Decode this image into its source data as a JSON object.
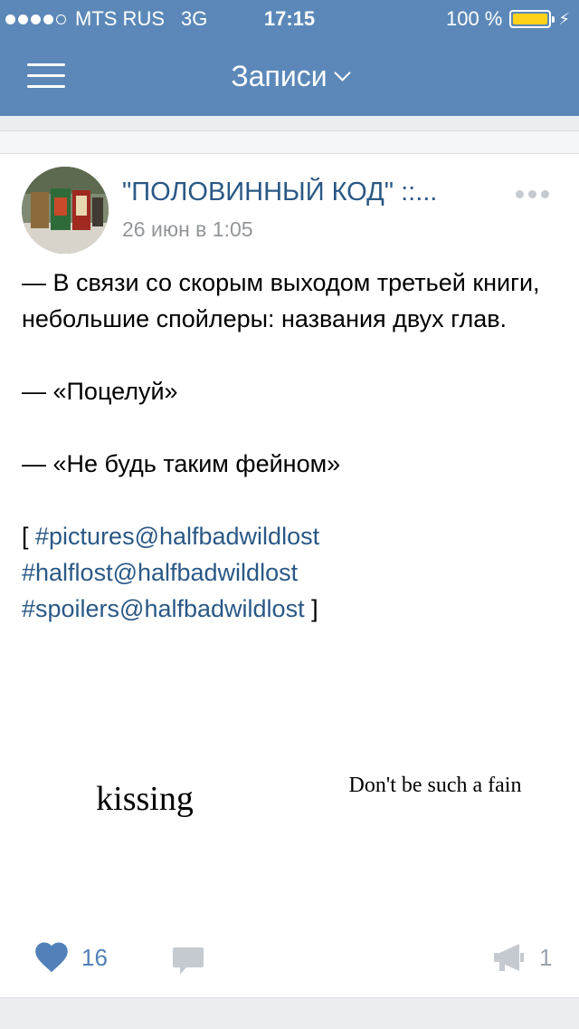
{
  "status_bar": {
    "carrier": "MTS RUS",
    "network": "3G",
    "time": "17:15",
    "battery": "100 %",
    "battery_level_percent": 100
  },
  "nav": {
    "title": "Записи",
    "menu_icon": "hamburger-icon",
    "dropdown_icon": "chevron-down-icon"
  },
  "post": {
    "author": "\"ПОЛОВИННЫЙ КОД\" ::...",
    "date": "26 июн в 1:05",
    "avatar_icon": "group-avatar",
    "lines": [
      "— В связи со скорым выходом третьей книги, небольшие спойлеры: названия двух глав.",
      "— «Поцелуй»",
      "— «Не будь таким фейном»"
    ],
    "tags_open": "[ ",
    "tags": [
      "#pictures@halfbadwildlost",
      "#halflost@halfbadwildlost",
      "#spoilers@halfbadwildlost"
    ],
    "tags_close": " ]",
    "images": [
      {
        "caption": "kissing"
      },
      {
        "caption": "Don't be such a fain"
      }
    ]
  },
  "actions": {
    "likes": "16",
    "shares": "1",
    "like_icon": "heart-icon",
    "comment_icon": "comment-icon",
    "share_icon": "megaphone-icon",
    "like_color": "#5181b8",
    "muted_color": "#c5cad1"
  },
  "colors": {
    "header": "#5b88b8",
    "link": "#2a5885",
    "battery": "#ffd21a"
  }
}
